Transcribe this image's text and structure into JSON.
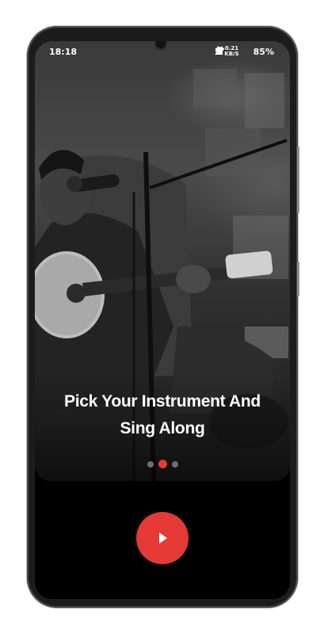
{
  "status_bar": {
    "time": "18:18",
    "data_speed_top": "0.21",
    "data_speed_bottom": "KB/S",
    "battery": "85%"
  },
  "onboarding": {
    "title_line1": "Pick Your Instrument And",
    "title_line2": "Sing Along",
    "page_indicator": {
      "total": 3,
      "active_index": 1
    }
  },
  "colors": {
    "accent": "#e53935",
    "background": "#000000"
  },
  "icons": {
    "status": [
      "alarm-icon",
      "bluetooth-icon",
      "wifi-icon",
      "signal-icon",
      "battery-icon"
    ],
    "action": "play-icon"
  }
}
